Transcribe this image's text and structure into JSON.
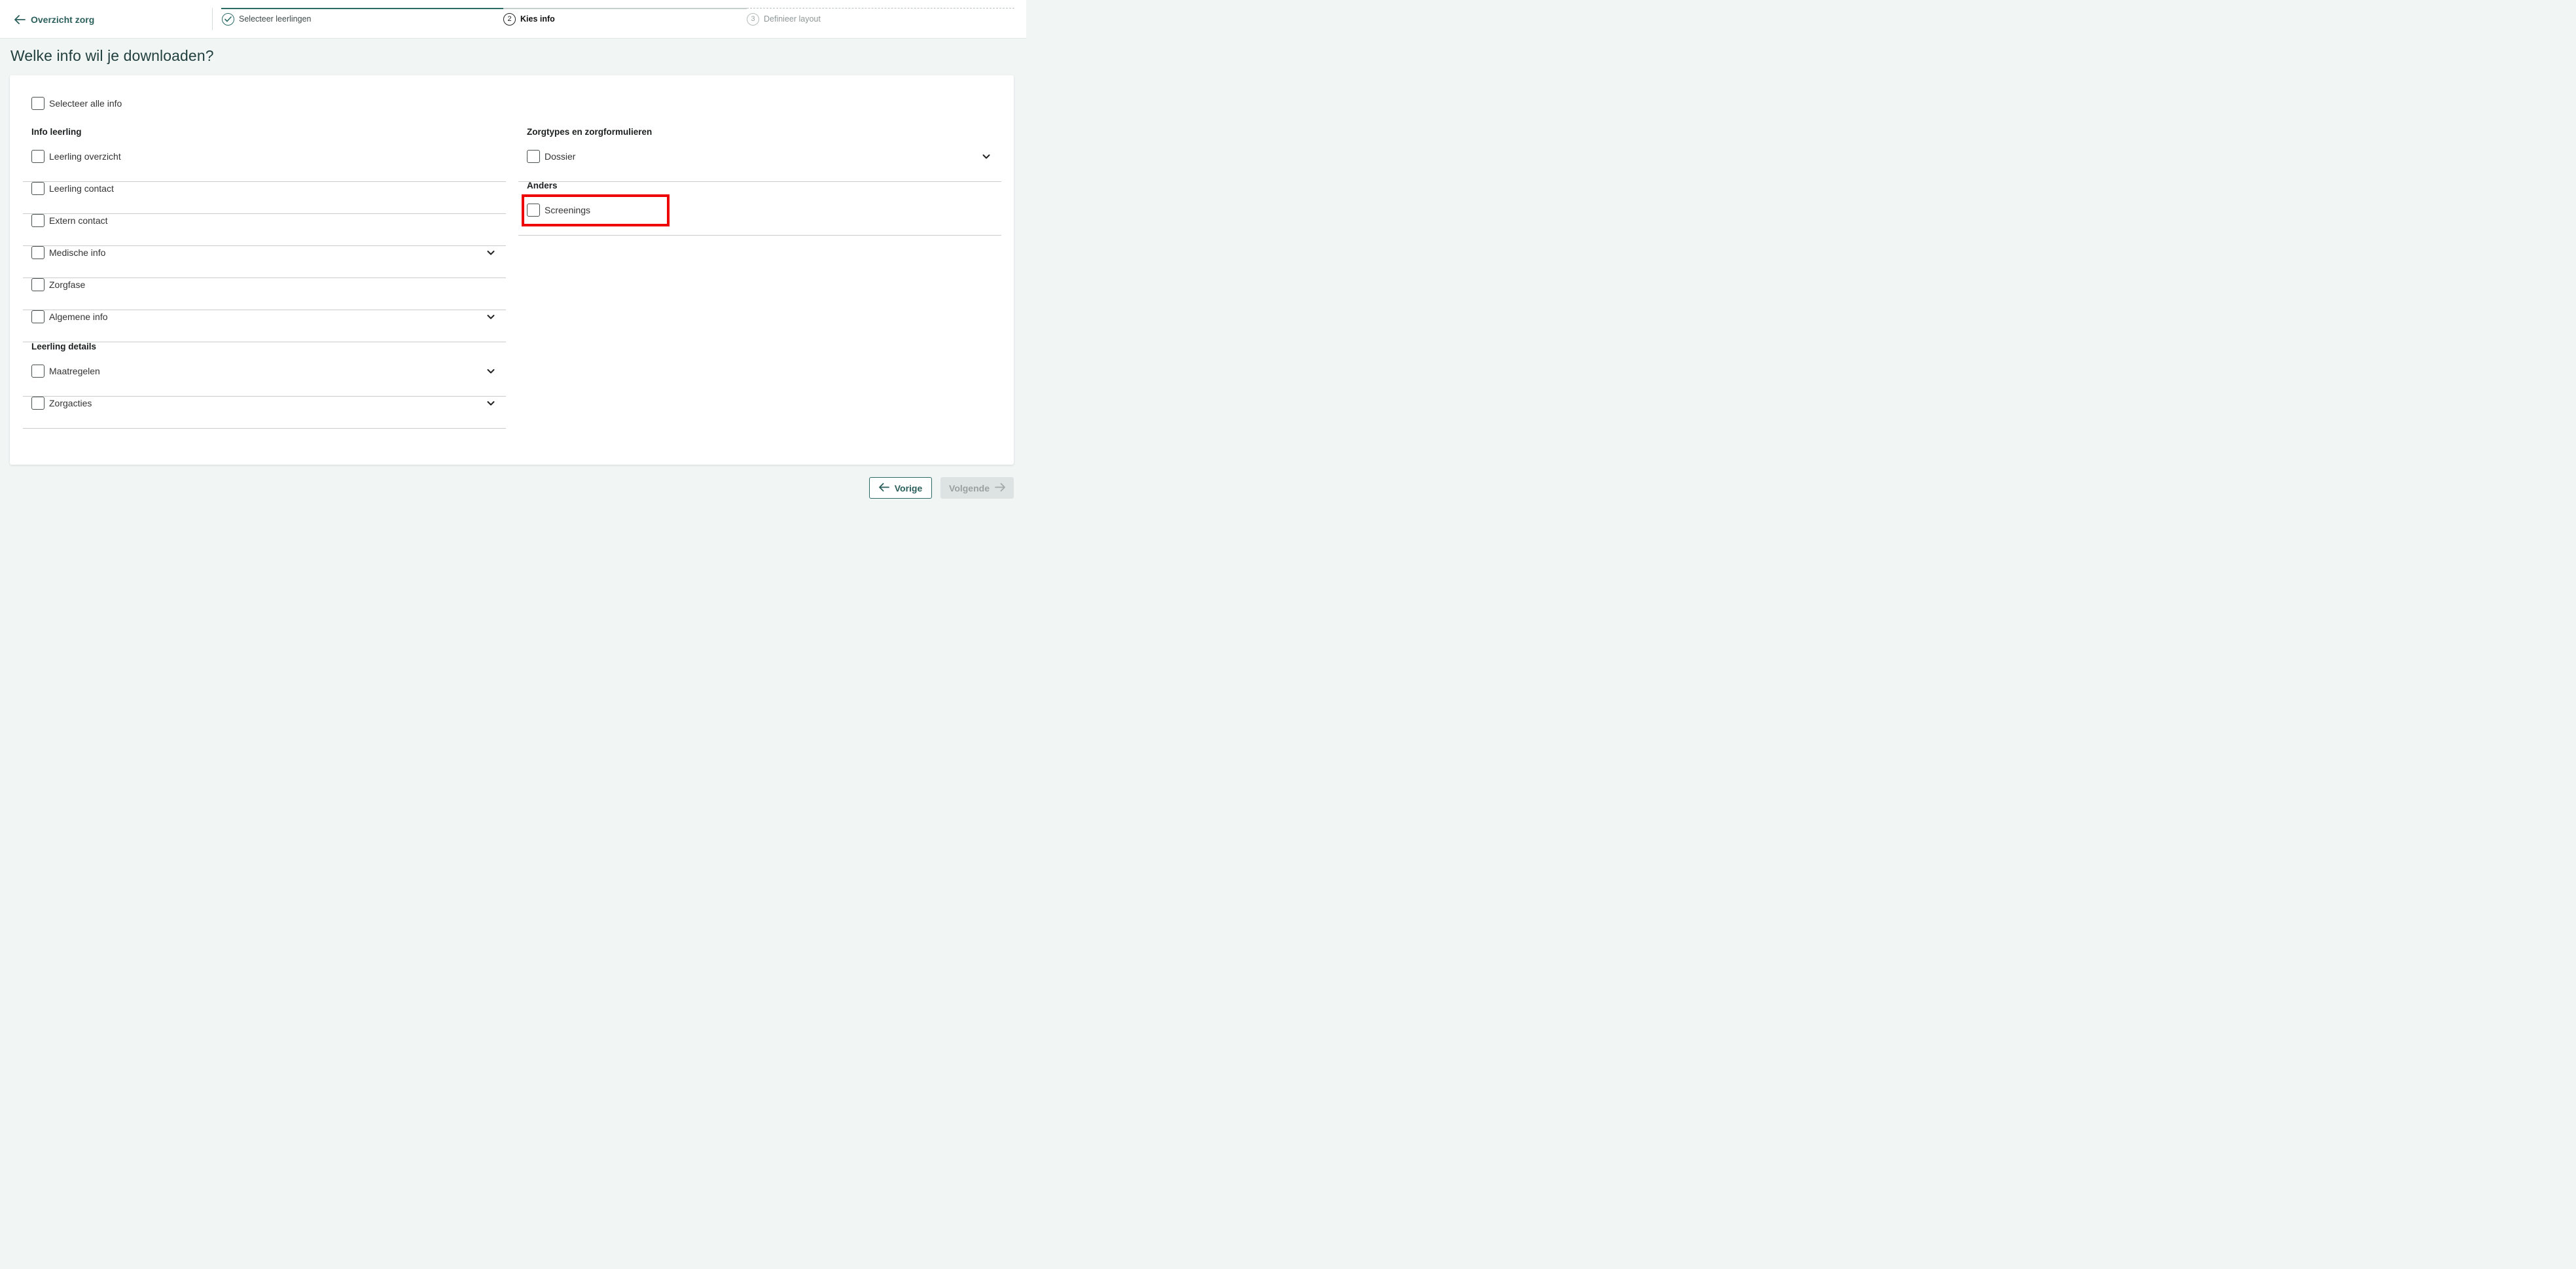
{
  "header": {
    "back_label": "Overzicht zorg",
    "steps": [
      {
        "number": "1",
        "label": "Selecteer leerlingen",
        "state": "done"
      },
      {
        "number": "2",
        "label": "Kies info",
        "state": "active"
      },
      {
        "number": "3",
        "label": "Definieer layout",
        "state": "todo"
      }
    ]
  },
  "page": {
    "title": "Welke info wil je downloaden?"
  },
  "form": {
    "select_all_label": "Selecteer alle info",
    "left": {
      "section_info_leerling": "Info leerling",
      "items_info_leerling": [
        {
          "label": "Leerling overzicht",
          "expandable": false
        },
        {
          "label": "Leerling contact",
          "expandable": false
        },
        {
          "label": "Extern contact",
          "expandable": false
        },
        {
          "label": "Medische info",
          "expandable": true
        },
        {
          "label": "Zorgfase",
          "expandable": false
        },
        {
          "label": "Algemene info",
          "expandable": true
        }
      ],
      "section_leerling_details": "Leerling details",
      "items_leerling_details": [
        {
          "label": "Maatregelen",
          "expandable": true
        },
        {
          "label": "Zorgacties",
          "expandable": true
        }
      ]
    },
    "right": {
      "section_zorgtypes": "Zorgtypes en zorgformulieren",
      "items_zorgtypes": [
        {
          "label": "Dossier",
          "expandable": true
        }
      ],
      "section_anders": "Anders",
      "items_anders": [
        {
          "label": "Screenings",
          "expandable": false,
          "highlighted": true
        }
      ]
    }
  },
  "footer": {
    "prev_label": "Vorige",
    "next_label": "Volgende",
    "next_disabled": true
  },
  "colors": {
    "accent": "#2b6b66",
    "highlight": "#ee0000",
    "background": "#f1f6f5"
  },
  "icons": {
    "back": "arrow-left-icon",
    "step_done": "check-circle-icon",
    "expand": "chevron-down-icon",
    "next": "arrow-right-icon"
  }
}
